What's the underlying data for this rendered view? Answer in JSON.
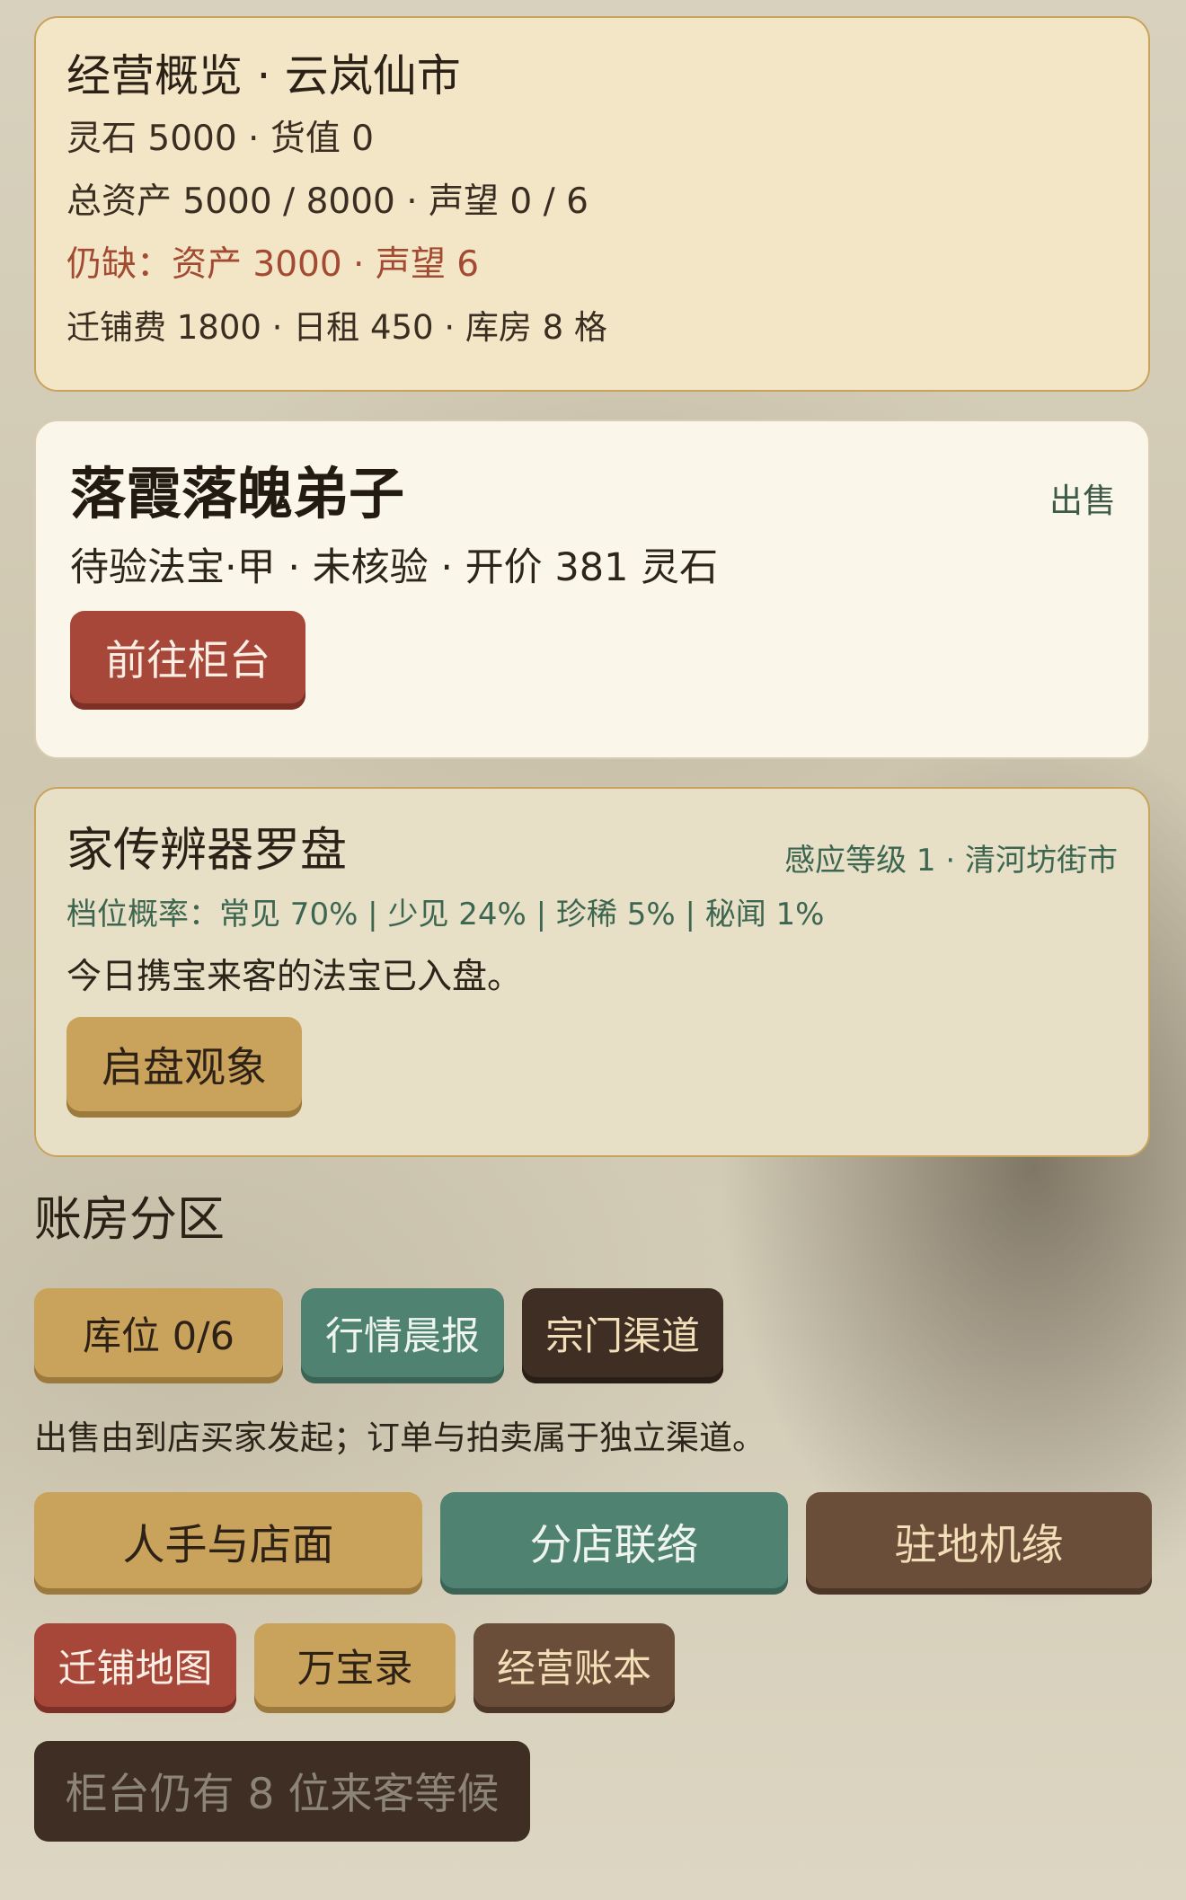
{
  "overview": {
    "title": "经营概览 · 云岚仙市",
    "line1": "灵石 5000 · 货值 0",
    "line2": "总资产 5000 / 8000 · 声望 0 / 6",
    "line3": "仍缺：资产 3000 · 声望 6",
    "line4": "迁铺费 1800 · 日租 450 · 库房 8 格"
  },
  "customer": {
    "name": "落霞落魄弟子",
    "tag": "出售",
    "detail": "待验法宝·甲 · 未核验 · 开价 381 灵石",
    "button": "前往柜台"
  },
  "compass": {
    "title": "家传辨器罗盘",
    "meta": "感应等级 1 · 清河坊街市",
    "probs": "档位概率：常见 70% | 少见 24% | 珍稀 5% | 秘闻 1%",
    "note": "今日携宝来客的法宝已入盘。",
    "button": "启盘观象"
  },
  "section": {
    "title": "账房分区",
    "tabs": [
      "库位 0/6",
      "行情晨报",
      "宗门渠道"
    ],
    "hint": "出售由到店买家发起；订单与拍卖属于独立渠道。",
    "row2": [
      "人手与店面",
      "分店联络",
      "驻地机缘"
    ],
    "row3": [
      "迁铺地图",
      "万宝录",
      "经营账本"
    ],
    "waiting": "柜台仍有 8 位来客等候"
  }
}
